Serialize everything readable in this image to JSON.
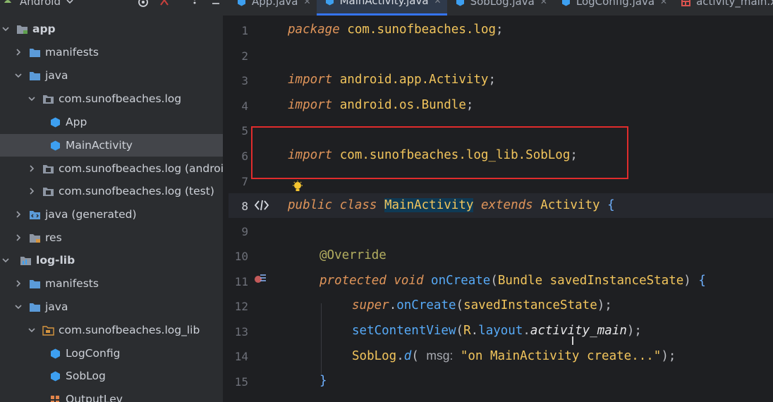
{
  "project_view": {
    "label": "Android"
  },
  "tabs": [
    {
      "label": "App.java"
    },
    {
      "label": "MainActivity.java"
    },
    {
      "label": "SobLog.java"
    },
    {
      "label": "LogConfig.java"
    },
    {
      "label": "activity_main.xml"
    }
  ],
  "tree": {
    "app": "app",
    "manifests1": "manifests",
    "java1": "java",
    "pkg_log": "com.sunofbeaches.log",
    "app_class": "App",
    "mainactivity": "MainActivity",
    "pkg_android_test": "com.sunofbeaches.log (androidTest)",
    "pkg_test": "com.sunofbeaches.log (test)",
    "java_generated": "java (generated)",
    "res": "res",
    "log_lib": "log-lib",
    "manifests2": "manifests",
    "java2": "java",
    "pkg_log_lib": "com.sunofbeaches.log_lib",
    "logconfig": "LogConfig",
    "soblog": "SobLog",
    "outputlev": "OutputLev"
  },
  "editor": {
    "line_numbers": [
      "1",
      "2",
      "3",
      "4",
      "5",
      "6",
      "7",
      "8",
      "9",
      "10",
      "11",
      "12",
      "13",
      "14",
      "15"
    ],
    "l1_kw": "package",
    "l1_pkg": " com.sunofbeaches.log",
    "l1_end": ";",
    "l3_kw": "import",
    "l3_pkg": " android.app.Activity",
    "l3_end": ";",
    "l4_kw": "import",
    "l4_pkg": " android.os.Bundle",
    "l4_end": ";",
    "l6_kw": "import",
    "l6_pkg": " com.sunofbeaches.log_lib.SobLog",
    "l6_end": ";",
    "l8_kw": "public class ",
    "l8_name": "MainActivity",
    "l8_ext": " extends ",
    "l8_sup": "Activity",
    "l8_brace": " {",
    "l10_ann": "@Override",
    "l11_kw": "protected void ",
    "l11_fn": "onCreate",
    "l11_open": "(",
    "l11_type": "Bundle",
    "l11_param": " savedInstanceState",
    "l11_close": ") ",
    "l11_brace": "{",
    "l12_kw": "super",
    "l12_dot": ".",
    "l12_fn": "onCreate",
    "l12_args": "(",
    "l12_param": "savedInstanceState",
    "l12_end": ");",
    "l13_fn": "setContentView",
    "l13_open": "(",
    "l13_r": "R",
    "l13_dot1": ".",
    "l13_layout": "layout",
    "l13_dot2": ".",
    "l13_main": "activity_main",
    "l13_end": ");",
    "l14_cls": "SobLog",
    "l14_dot": ".",
    "l14_fn": "d",
    "l14_open": "( ",
    "l14_hint": "msg:",
    "l14_str": " \"on MainActivity create...\"",
    "l14_end": ");",
    "l15_brace": "}"
  },
  "colors": {
    "highlight_box": "#e02c2c",
    "keyword": "#e0955a",
    "type": "#f2c55c",
    "method": "#57aaf7",
    "annotation": "#b3ae60",
    "active_tab_underline": "#3574f0"
  },
  "icons": {
    "android": "android-icon",
    "folder": "folder-icon",
    "package": "package-icon",
    "class": "class-icon",
    "bulb": "lightbulb-icon",
    "override": "override-marker-icon",
    "implement": "implement-marker-icon"
  }
}
